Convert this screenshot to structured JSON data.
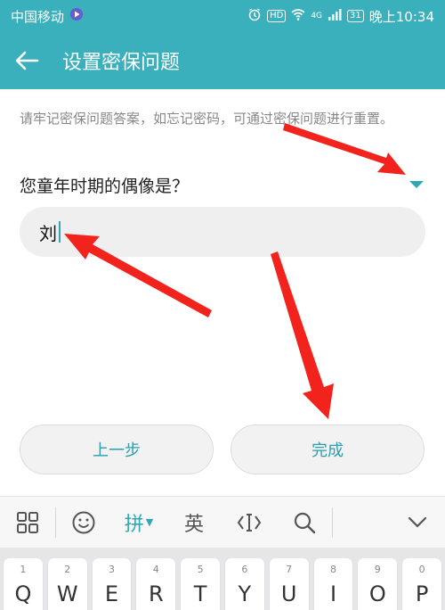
{
  "status_bar": {
    "carrier": "中国移动",
    "hd": "HD",
    "network": "4G",
    "battery": "31",
    "time": "晚上10:34"
  },
  "app_bar": {
    "title": "设置密保问题"
  },
  "hint_text": "请牢记密保问题答案，如忘记密码，可通过密保问题进行重置。",
  "question": {
    "label": "您童年时期的偶像是？"
  },
  "answer": {
    "value": "刘"
  },
  "buttons": {
    "prev": "上一步",
    "done": "完成"
  },
  "keyboard": {
    "toolbar": {
      "pinyin": "拼",
      "english": "英"
    },
    "keys": [
      {
        "num": "1",
        "letter": "Q"
      },
      {
        "num": "2",
        "letter": "W"
      },
      {
        "num": "3",
        "letter": "E"
      },
      {
        "num": "4",
        "letter": "R"
      },
      {
        "num": "5",
        "letter": "T"
      },
      {
        "num": "6",
        "letter": "Y"
      },
      {
        "num": "7",
        "letter": "U"
      },
      {
        "num": "8",
        "letter": "I"
      },
      {
        "num": "9",
        "letter": "O"
      },
      {
        "num": "0",
        "letter": "P"
      }
    ]
  },
  "colors": {
    "accent": "#3ab0bd",
    "annotation_arrow": "#f2221d"
  }
}
